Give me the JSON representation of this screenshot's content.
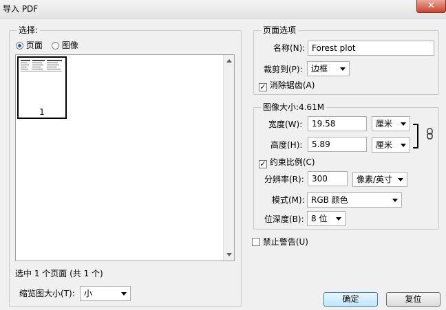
{
  "window": {
    "title": "导入 PDF",
    "close_glyph": "✕"
  },
  "select_group": {
    "legend": "选择:",
    "radio_pages": "页面",
    "radio_images": "图像",
    "thumbnail_page_number": "1",
    "selection_status": "选中 1 个页面 (共 1 个)",
    "thumb_size_label": "缩览图大小(T):",
    "thumb_size_value": "小"
  },
  "page_options": {
    "legend": "页面选项",
    "name_label": "名称(N):",
    "name_value": "Forest plot",
    "crop_label": "裁剪到(P):",
    "crop_value": "边框",
    "antialias_label": "消除锯齿(A)",
    "antialias_checked": true
  },
  "image_size": {
    "legend": "图像大小:4.61M",
    "width_label": "宽度(W):",
    "width_value": "19.58",
    "width_unit": "厘米",
    "height_label": "高度(H):",
    "height_value": "5.89",
    "height_unit": "厘米",
    "constrain_label": "约束比例(C)",
    "constrain_checked": true,
    "resolution_label": "分辨率(R):",
    "resolution_value": "300",
    "resolution_unit": "像素/英寸",
    "mode_label": "模式(M):",
    "mode_value": "RGB 颜色",
    "bitdepth_label": "位深度(B):",
    "bitdepth_value": "8 位"
  },
  "suppress_warnings_label": "禁止警告(U)",
  "suppress_warnings_checked": false,
  "buttons": {
    "ok": "确定",
    "reset": "复位"
  },
  "check_glyph": "✓"
}
